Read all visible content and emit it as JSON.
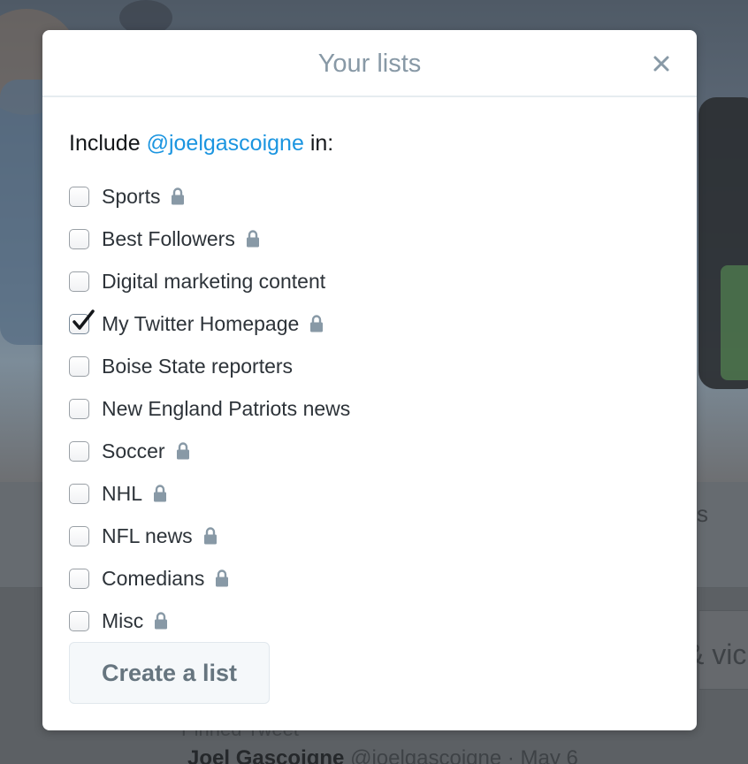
{
  "modal": {
    "title": "Your lists",
    "include_prefix": "Include",
    "mention": "@joelgascoigne",
    "include_suffix": "in:",
    "create_button": "Create a list"
  },
  "lists": [
    {
      "label": "Sports",
      "checked": false,
      "private": true
    },
    {
      "label": "Best Followers",
      "checked": false,
      "private": true
    },
    {
      "label": "Digital marketing content",
      "checked": false,
      "private": false
    },
    {
      "label": "My Twitter Homepage",
      "checked": true,
      "private": true
    },
    {
      "label": "Boise State reporters",
      "checked": false,
      "private": false
    },
    {
      "label": "New England Patriots news",
      "checked": false,
      "private": false
    },
    {
      "label": "Soccer",
      "checked": false,
      "private": true
    },
    {
      "label": "NHL",
      "checked": false,
      "private": true
    },
    {
      "label": "NFL news",
      "checked": false,
      "private": true
    },
    {
      "label": "Comedians",
      "checked": false,
      "private": true
    },
    {
      "label": "Misc",
      "checked": false,
      "private": true
    }
  ],
  "background": {
    "right_fragment_1": "s",
    "right_fragment_2": "& vic",
    "pinned_label": "Pinned Tweet",
    "author_name": "Joel Gascoigne",
    "author_handle": "@joelgascoigne · May 6"
  },
  "colors": {
    "accent": "#1b95e0",
    "title": "#8899a6",
    "checkmark": "#14171a",
    "lock": "#8899a6"
  },
  "icons": {
    "close": "close-icon",
    "lock": "lock-icon",
    "checkmark": "checkmark-icon"
  }
}
